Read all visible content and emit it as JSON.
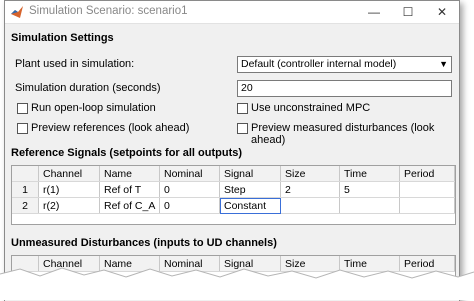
{
  "window": {
    "title": "Simulation Scenario: scenario1"
  },
  "settings": {
    "heading": "Simulation Settings",
    "plant_label": "Plant used in simulation:",
    "plant_value": "Default (controller internal model)",
    "duration_label": "Simulation duration (seconds)",
    "duration_value": "20",
    "checkboxes": [
      {
        "label": "Run open-loop simulation",
        "checked": false
      },
      {
        "label": "Use unconstrained MPC",
        "checked": false
      },
      {
        "label": "Preview references (look ahead)",
        "checked": false
      },
      {
        "label": "Preview measured disturbances (look ahead)",
        "checked": false
      }
    ]
  },
  "reference": {
    "heading": "Reference Signals (setpoints for all outputs)",
    "columns": [
      "",
      "Channel",
      "Name",
      "Nominal",
      "Signal",
      "Size",
      "Time",
      "Period"
    ],
    "rows": [
      [
        "1",
        "r(1)",
        "Ref of T",
        "0",
        "Step",
        "2",
        "5",
        ""
      ],
      [
        "2",
        "r(2)",
        "Ref of C_A",
        "0",
        "Constant",
        "",
        "",
        ""
      ]
    ]
  },
  "unmeasured": {
    "heading": "Unmeasured Disturbances (inputs to UD channels)",
    "columns": [
      "",
      "Channel",
      "Name",
      "Nominal",
      "Signal",
      "Size",
      "Time",
      "Period"
    ]
  }
}
